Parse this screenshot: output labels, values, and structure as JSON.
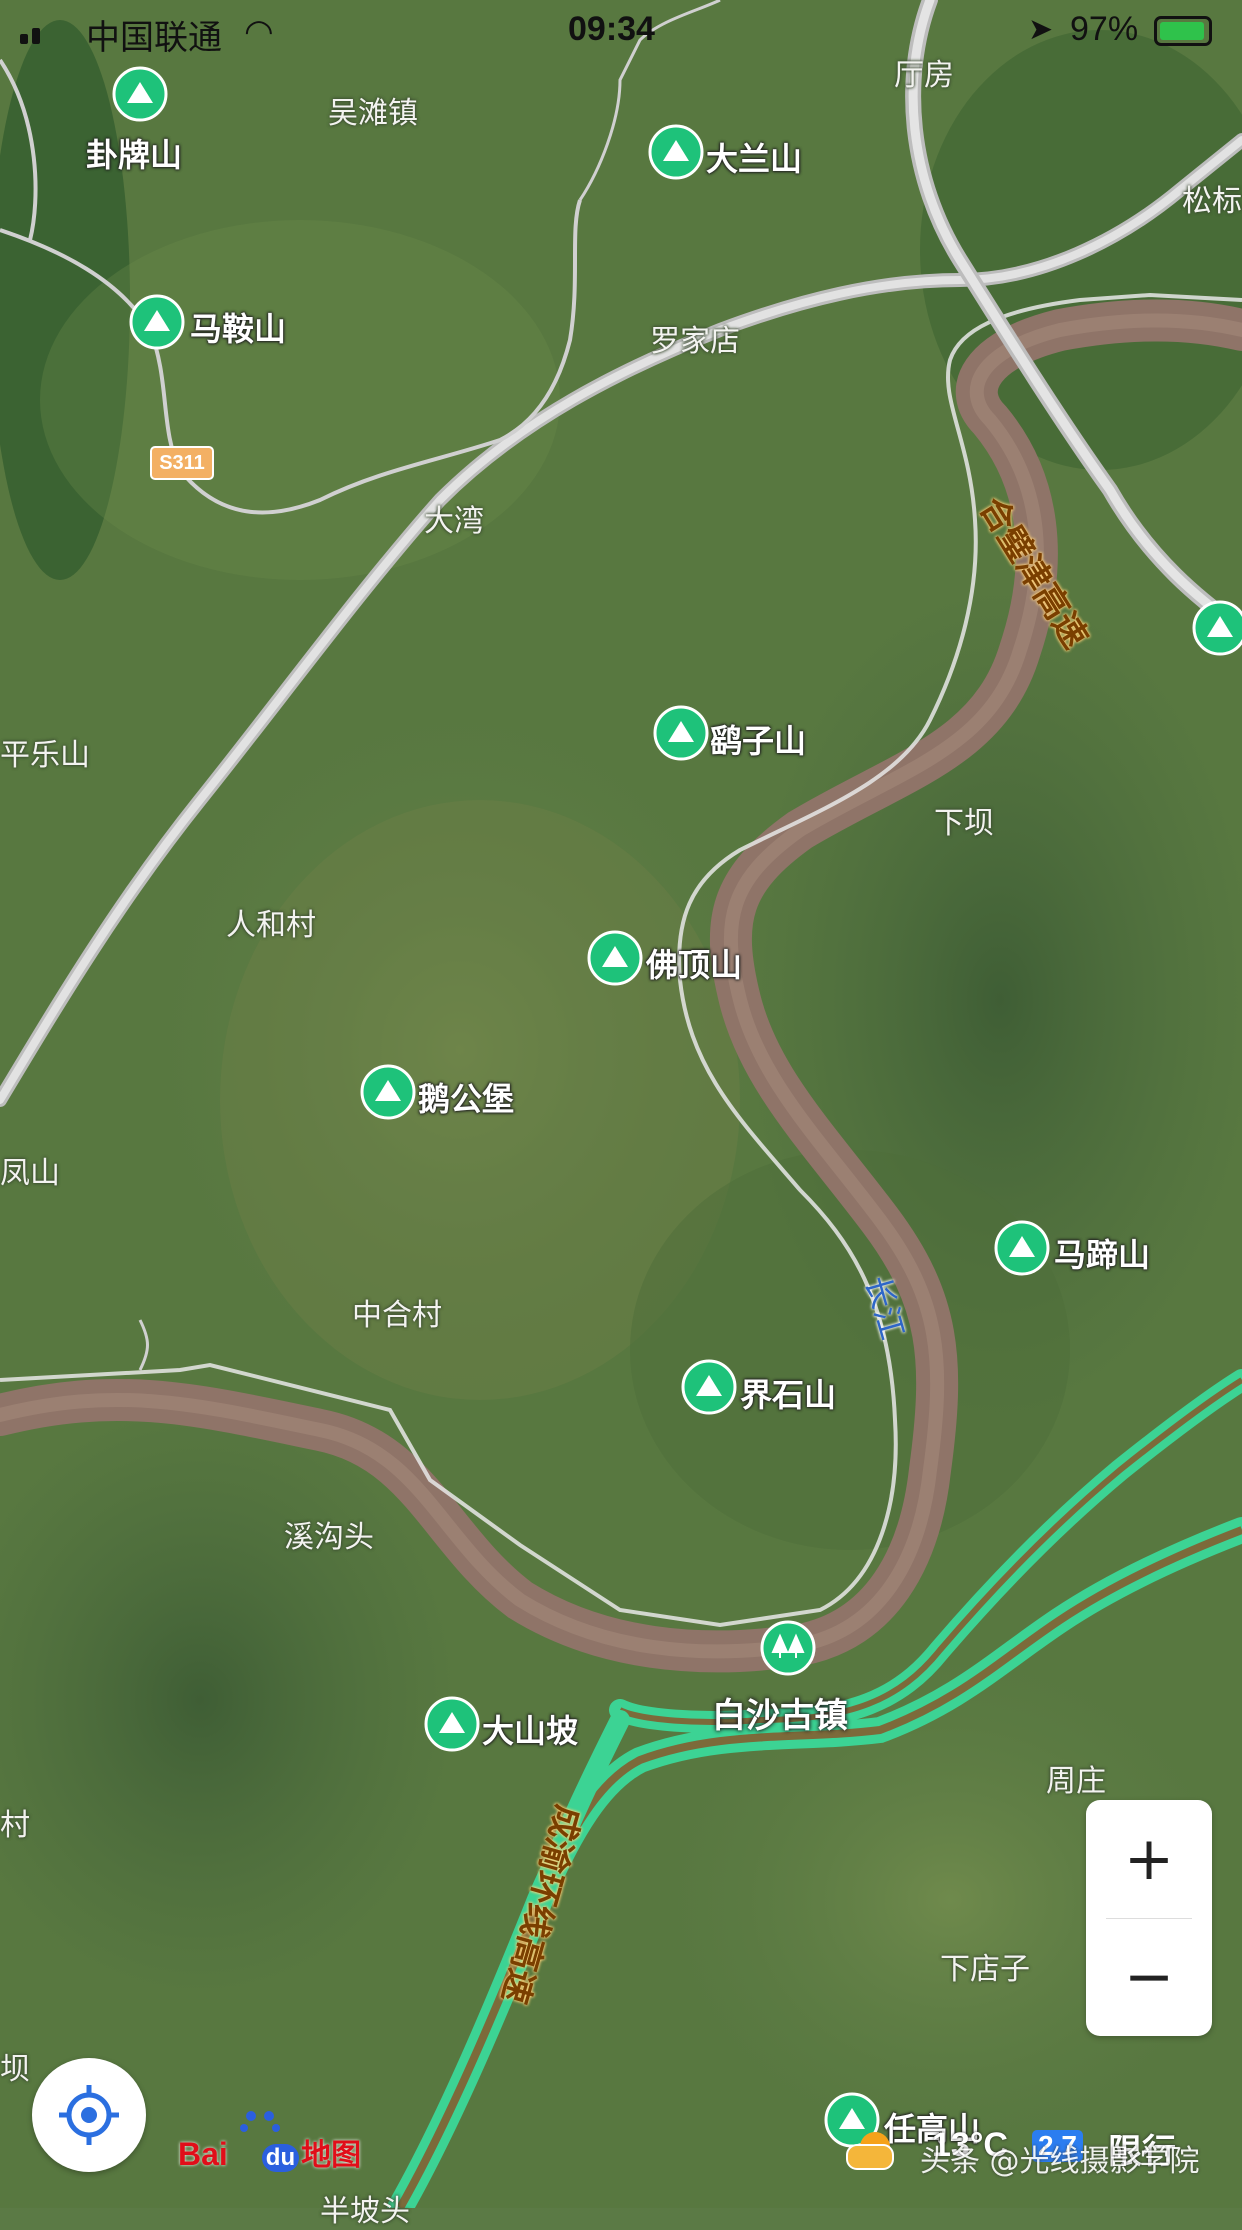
{
  "status_bar": {
    "carrier": "中国联通",
    "time": "09:34",
    "battery": "97%"
  },
  "places": {
    "wutan": "吴滩镇",
    "tingfang": "厅房",
    "songji": "松标",
    "luojiadian": "罗家店",
    "dawan": "大湾",
    "xiaba": "下坝",
    "renhecun": "人和村",
    "zhonghecun": "中合村",
    "xigoutou": "溪沟头",
    "zhouzhuang": "周庄",
    "xiadianzi": "下店子",
    "banpotou": "半坡头",
    "fengshan_left": "凤山",
    "pingle_left": "平乐山",
    "cun_left": "村",
    "ba_left": "坝"
  },
  "pois": {
    "guapaishan": "卦牌山",
    "masanshan": "马鞍山",
    "dalanshan": "大兰山",
    "yaozishan": "鹞子山",
    "fodingshan": "佛顶山",
    "egongbao": "鹅公堡",
    "matishan": "马蹄山",
    "jieshishan": "界石山",
    "dashanpo": "大山坡",
    "rengaoshan": "任高山"
  },
  "town": {
    "baisha": "白沙古镇"
  },
  "road_shield": "S311",
  "highways": {
    "hebijin": "合璧津高速",
    "chengyu": "成渝环线高速"
  },
  "river": "长江",
  "zoom": {
    "in": "+",
    "out": "−"
  },
  "logo": {
    "bai": "Bai",
    "du": "du",
    "map": "地图"
  },
  "watermark": "头条 @光线摄影学院",
  "weather": {
    "temp": "13°C",
    "restrict_num": "2 7",
    "restrict": "限行"
  },
  "colors": {
    "poi_green": "#1ec27a",
    "highway_green": "#3cd394",
    "river": "#8f7468",
    "road_white": "#e6e6e6",
    "logo_red": "#e10e19",
    "logo_blue": "#2b5fde"
  }
}
